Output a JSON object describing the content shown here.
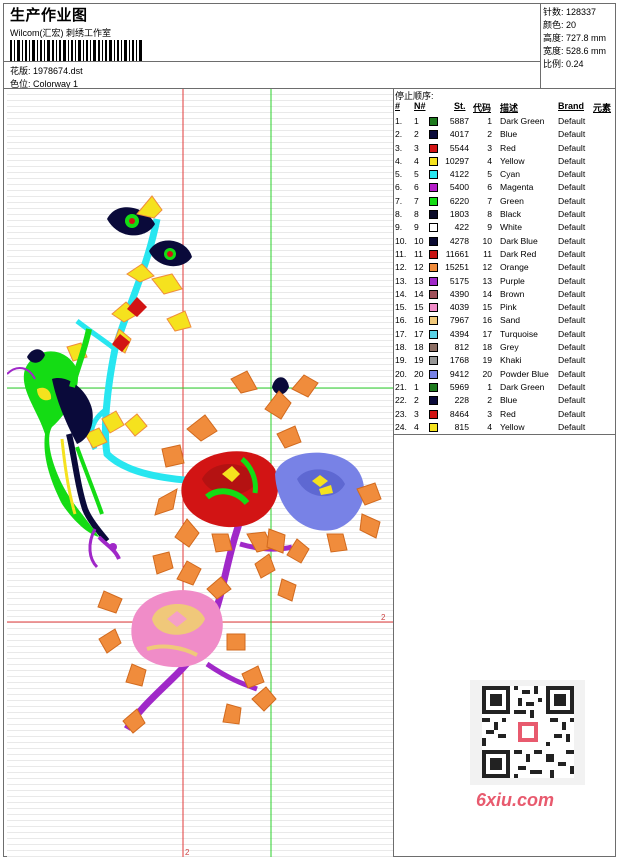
{
  "header": {
    "title": "生产作业图",
    "subtitle": "Wilcom(汇宏) 刺绣工作室",
    "design_label": "花版:",
    "design_value": "1978674.dst",
    "colorway_label": "色位:",
    "colorway_value": "Colorway 1"
  },
  "stats": {
    "stitches": "针数: 128337",
    "colors": "颜色: 20",
    "height": "高度: 727.8 mm",
    "width": "宽度: 528.6 mm",
    "scale": "比例: 0.24"
  },
  "table": {
    "heading": "停止顺序:",
    "columns": [
      "#",
      "N#",
      "St.",
      "代码",
      "描述",
      "Brand",
      "元素"
    ],
    "rows": [
      {
        "idx": "1.",
        "n": "1",
        "st": "5887",
        "code": "1",
        "desc": "Dark Green",
        "brand": "Default",
        "color": "#1e7a1e"
      },
      {
        "idx": "2.",
        "n": "2",
        "st": "4017",
        "code": "2",
        "desc": "Blue",
        "brand": "Default",
        "color": "#0a0a3a"
      },
      {
        "idx": "3.",
        "n": "3",
        "st": "5544",
        "code": "3",
        "desc": "Red",
        "brand": "Default",
        "color": "#d21414"
      },
      {
        "idx": "4.",
        "n": "4",
        "st": "10297",
        "code": "4",
        "desc": "Yellow",
        "brand": "Default",
        "color": "#f5e21e"
      },
      {
        "idx": "5.",
        "n": "5",
        "st": "4122",
        "code": "5",
        "desc": "Cyan",
        "brand": "Default",
        "color": "#28e6f0"
      },
      {
        "idx": "6.",
        "n": "6",
        "st": "5400",
        "code": "6",
        "desc": "Magenta",
        "brand": "Default",
        "color": "#b41ec8"
      },
      {
        "idx": "7.",
        "n": "7",
        "st": "6220",
        "code": "7",
        "desc": "Green",
        "brand": "Default",
        "color": "#14dc14"
      },
      {
        "idx": "8.",
        "n": "8",
        "st": "1803",
        "code": "8",
        "desc": "Black",
        "brand": "Default",
        "color": "#0a0a28"
      },
      {
        "idx": "9.",
        "n": "9",
        "st": "422",
        "code": "9",
        "desc": "White",
        "brand": "Default",
        "color": "#ffffff"
      },
      {
        "idx": "10.",
        "n": "10",
        "st": "4278",
        "code": "10",
        "desc": "Dark Blue",
        "brand": "Default",
        "color": "#0a0a32"
      },
      {
        "idx": "11.",
        "n": "11",
        "st": "11661",
        "code": "11",
        "desc": "Dark Red",
        "brand": "Default",
        "color": "#c81414"
      },
      {
        "idx": "12.",
        "n": "12",
        "st": "15251",
        "code": "12",
        "desc": "Orange",
        "brand": "Default",
        "color": "#f08c3c"
      },
      {
        "idx": "13.",
        "n": "13",
        "st": "5175",
        "code": "13",
        "desc": "Purple",
        "brand": "Default",
        "color": "#a028c8"
      },
      {
        "idx": "14.",
        "n": "14",
        "st": "4390",
        "code": "14",
        "desc": "Brown",
        "brand": "Default",
        "color": "#a0505a"
      },
      {
        "idx": "15.",
        "n": "15",
        "st": "4039",
        "code": "15",
        "desc": "Pink",
        "brand": "Default",
        "color": "#f08cc8"
      },
      {
        "idx": "16.",
        "n": "16",
        "st": "7967",
        "code": "16",
        "desc": "Sand",
        "brand": "Default",
        "color": "#f0c87a"
      },
      {
        "idx": "17.",
        "n": "17",
        "st": "4394",
        "code": "17",
        "desc": "Turquoise",
        "brand": "Default",
        "color": "#5ad2e6"
      },
      {
        "idx": "18.",
        "n": "18",
        "st": "812",
        "code": "18",
        "desc": "Grey",
        "brand": "Default",
        "color": "#8c6e64"
      },
      {
        "idx": "19.",
        "n": "19",
        "st": "1768",
        "code": "19",
        "desc": "Khaki",
        "brand": "Default",
        "color": "#969696"
      },
      {
        "idx": "20.",
        "n": "20",
        "st": "9412",
        "code": "20",
        "desc": "Powder Blue",
        "brand": "Default",
        "color": "#7882e6"
      },
      {
        "idx": "21.",
        "n": "1",
        "st": "5969",
        "code": "1",
        "desc": "Dark Green",
        "brand": "Default",
        "color": "#1e7a1e"
      },
      {
        "idx": "22.",
        "n": "2",
        "st": "228",
        "code": "2",
        "desc": "Blue",
        "brand": "Default",
        "color": "#0a0a3a"
      },
      {
        "idx": "23.",
        "n": "3",
        "st": "8464",
        "code": "3",
        "desc": "Red",
        "brand": "Default",
        "color": "#d21414"
      },
      {
        "idx": "24.",
        "n": "4",
        "st": "815",
        "code": "4",
        "desc": "Yellow",
        "brand": "Default",
        "color": "#f5e21e"
      }
    ]
  },
  "canvas": {
    "axis_label_right": "2",
    "axis_label_bottom": "2"
  },
  "watermark": {
    "site": "6xiu.com"
  }
}
